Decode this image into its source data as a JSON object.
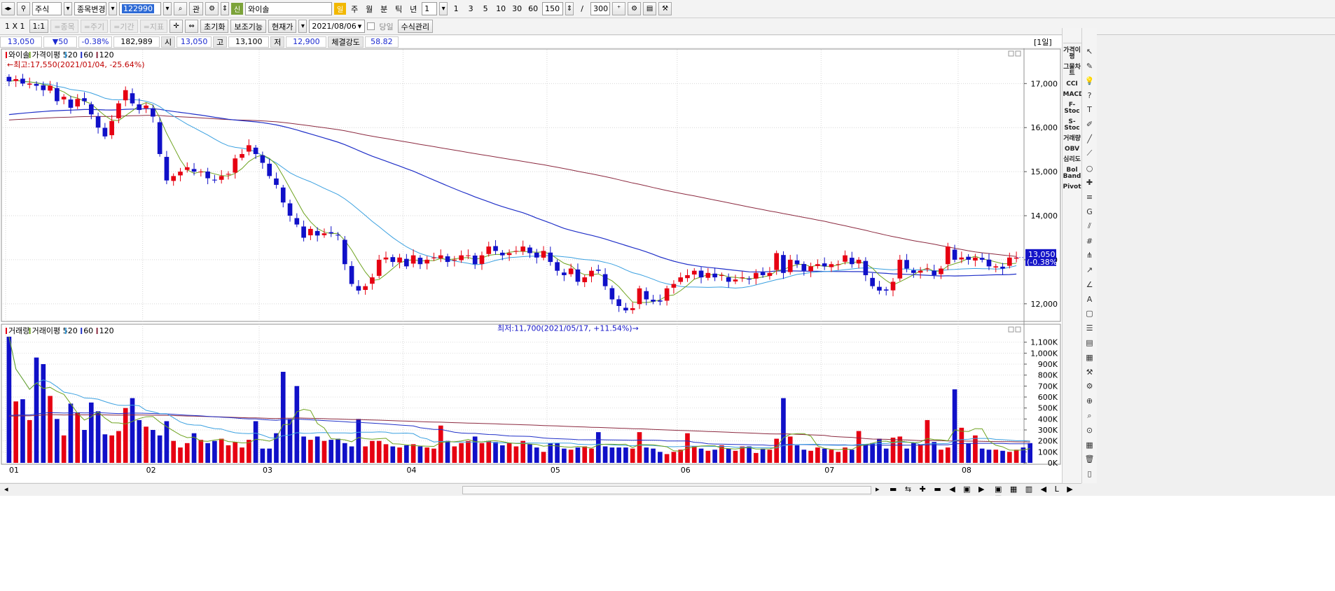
{
  "toolbar": {
    "market": "주식",
    "mode": "종목변경",
    "code": "122990",
    "btn_gwan": "관",
    "stock_name": "와이솔",
    "badge_day": "일",
    "badge_sin": "신",
    "periods": [
      "주",
      "월",
      "분",
      "틱",
      "년"
    ],
    "unit_value": "1",
    "minutes": [
      "1",
      "3",
      "5",
      "10",
      "30",
      "60"
    ],
    "count": "150",
    "slash": "/",
    "total": "300"
  },
  "toolbar2": {
    "layout": "1 X 1",
    "layout_btn": "1:1",
    "disabled": [
      "=종목",
      "=주기",
      "=기간",
      "=지표"
    ],
    "reset": "초기화",
    "aux": "보조기능",
    "price": "현재가",
    "date": "2021/08/06",
    "same_day": "당일",
    "formula": "수식관리"
  },
  "quote": {
    "price": "13,050",
    "change": "▼50",
    "rate": "-0.38%",
    "volume": "182,989",
    "open_label": "시",
    "open": "13,050",
    "high_label": "고",
    "high": "13,100",
    "low_label": "저",
    "low": "12,900",
    "strength_label": "체결강도",
    "strength": "58.82",
    "period_tag": "[1일]"
  },
  "sidebar_indicators": [
    "가격이평",
    "그물차트",
    "CCI",
    "MACD",
    "F-Stoc",
    "S-Stoc",
    "거래량",
    "OBV",
    "심리도",
    "Bol Band",
    "Pivot"
  ],
  "sidebar_tools": [
    "cursor-icon",
    "eraser-icon",
    "lightbulb-icon",
    "question-icon",
    "text-tool-icon",
    "brush-icon",
    "trendline-icon",
    "diagonal-icon",
    "circle-icon",
    "cross-icon",
    "fibo-icon",
    "gann-icon",
    "channel-icon",
    "grid-icon",
    "andrews-icon",
    "arrow-icon",
    "angle-icon",
    "auto-icon",
    "window-icon",
    "list-icon",
    "chart-icon",
    "table-icon",
    "wrench-icon",
    "settings-icon",
    "zoom-icon",
    "search-icon",
    "magnify-icon",
    "calendar-icon",
    "trash-icon",
    "mobile-icon"
  ],
  "colors": {
    "up": "#e60012",
    "down": "#1010c8",
    "ma5": "#6ea31f",
    "ma20": "#3aa0e0",
    "ma60": "#2030c8",
    "ma120": "#8c2a40",
    "axis_text": "#000000",
    "price_tag": "#1414c8"
  },
  "chart_data": {
    "type": "candlestick",
    "price_legend": {
      "name": "와이솔",
      "ma_label": "가격이평",
      "periods": [
        "5",
        "20",
        "60",
        "120"
      ]
    },
    "volume_legend": {
      "name": "거래량",
      "ma_label": "거래이평",
      "periods": [
        "5",
        "20",
        "60",
        "120"
      ]
    },
    "high_annotation": "←최고:17,550(2021/01/04, -25.64%)",
    "low_annotation": "최저:11,700(2021/05/17, +11.54%)→",
    "current_tag": [
      "13,050",
      "(-0.38%)"
    ],
    "price_ylim": [
      11600,
      17800
    ],
    "price_ticks": [
      12000,
      13000,
      14000,
      15000,
      16000,
      17000
    ],
    "price_tick_labels": [
      "12,000",
      "13,000",
      "14,000",
      "15,000",
      "16,000",
      "17,000"
    ],
    "volume_ylim": [
      0,
      1200000
    ],
    "volume_ticks": [
      0,
      100000,
      200000,
      300000,
      400000,
      500000,
      600000,
      700000,
      800000,
      900000,
      1000000,
      1100000
    ],
    "volume_tick_labels": [
      "0K",
      "100K",
      "200K",
      "300K",
      "400K",
      "500K",
      "600K",
      "700K",
      "800K",
      "900K",
      "1,000K",
      "1,100K"
    ],
    "month_labels": [
      "01",
      "02",
      "03",
      "04",
      "05",
      "06",
      "07",
      "08"
    ],
    "month_index": [
      0,
      20,
      37,
      58,
      79,
      98,
      119,
      139
    ],
    "close": [
      17050,
      17100,
      17000,
      17000,
      16950,
      16850,
      16950,
      16600,
      16700,
      16450,
      16650,
      16600,
      16300,
      16000,
      15800,
      16150,
      16550,
      16850,
      16550,
      16400,
      16500,
      16250,
      15400,
      14800,
      14900,
      15000,
      15100,
      15000,
      15000,
      14850,
      14800,
      14900,
      14950,
      15300,
      15400,
      15600,
      15400,
      15200,
      14900,
      14700,
      14300,
      14000,
      13800,
      13500,
      13700,
      13550,
      13600,
      13600,
      13550,
      12900,
      12450,
      12300,
      12400,
      12600,
      13000,
      13050,
      12950,
      13050,
      12850,
      13100,
      12900,
      13000,
      13050,
      13100,
      12950,
      13000,
      13100,
      13100,
      12900,
      13100,
      13300,
      13200,
      13100,
      13150,
      13200,
      13300,
      13150,
      13050,
      13200,
      12950,
      12750,
      12650,
      12800,
      12500,
      12600,
      12750,
      12750,
      12400,
      12100,
      11950,
      11850,
      11900,
      12350,
      12100,
      12050,
      12050,
      12350,
      12450,
      12600,
      12650,
      12750,
      12600,
      12700,
      12600,
      12650,
      12500,
      12550,
      12600,
      12550,
      12700,
      12650,
      12700,
      13150,
      12700,
      13000,
      12900,
      12750,
      12850,
      12900,
      12850,
      12900,
      12900,
      13100,
      12900,
      13000,
      12650,
      12400,
      12300,
      12300,
      12500,
      13000,
      12800,
      12700,
      12750,
      12800,
      12650,
      12800,
      13300,
      13000,
      13050,
      13000,
      13050,
      13000,
      12850,
      12850,
      12800,
      13050,
      13050
    ],
    "volume": [
      1150000,
      560000,
      580000,
      390000,
      960000,
      900000,
      610000,
      400000,
      250000,
      540000,
      460000,
      300000,
      550000,
      470000,
      260000,
      250000,
      290000,
      500000,
      590000,
      390000,
      330000,
      300000,
      250000,
      380000,
      200000,
      140000,
      180000,
      270000,
      210000,
      180000,
      200000,
      220000,
      160000,
      190000,
      140000,
      210000,
      380000,
      130000,
      130000,
      270000,
      830000,
      400000,
      700000,
      240000,
      210000,
      240000,
      200000,
      210000,
      220000,
      180000,
      150000,
      400000,
      150000,
      200000,
      200000,
      170000,
      150000,
      140000,
      160000,
      170000,
      150000,
      140000,
      130000,
      340000,
      200000,
      150000,
      180000,
      200000,
      240000,
      180000,
      200000,
      190000,
      160000,
      180000,
      150000,
      200000,
      170000,
      140000,
      100000,
      180000,
      180000,
      130000,
      120000,
      140000,
      150000,
      130000,
      280000,
      150000,
      140000,
      140000,
      140000,
      130000,
      280000,
      140000,
      130000,
      100000,
      80000,
      100000,
      120000,
      270000,
      150000,
      130000,
      110000,
      120000,
      160000,
      130000,
      110000,
      150000,
      150000,
      90000,
      130000,
      120000,
      220000,
      590000,
      240000,
      160000,
      120000,
      110000,
      140000,
      130000,
      120000,
      100000,
      140000,
      120000,
      290000,
      170000,
      180000,
      220000,
      130000,
      230000,
      240000,
      130000,
      180000,
      170000,
      390000,
      190000,
      120000,
      140000,
      670000,
      320000,
      180000,
      250000,
      130000,
      120000,
      120000,
      110000,
      100000,
      120000,
      140000,
      180000
    ]
  }
}
